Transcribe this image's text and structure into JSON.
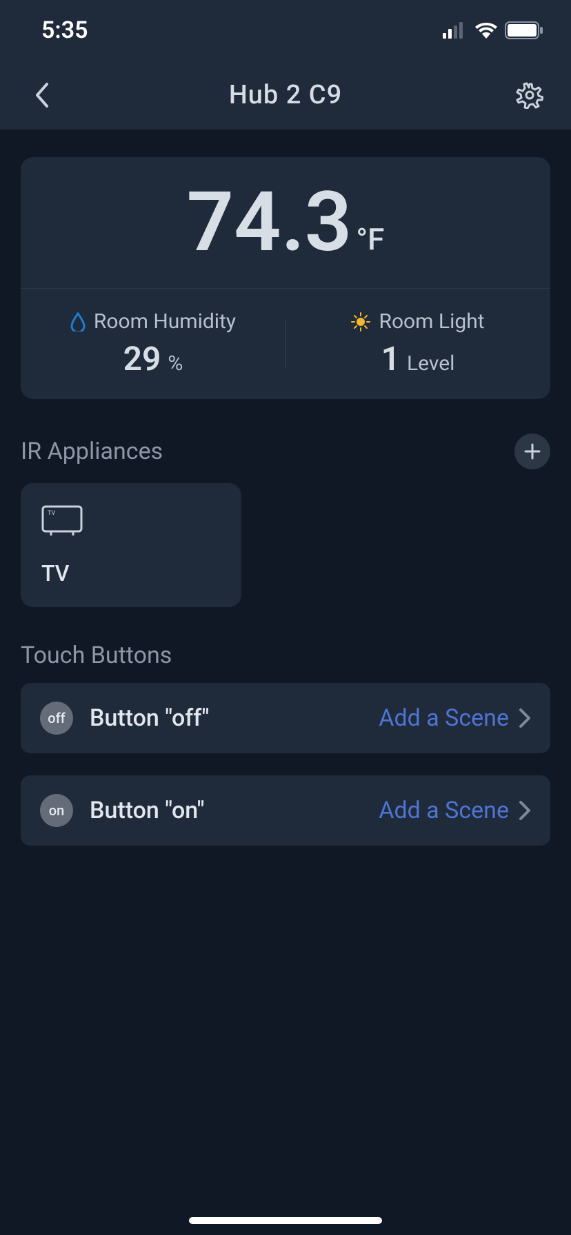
{
  "status": {
    "time": "5:35"
  },
  "header": {
    "title": "Hub 2 C9"
  },
  "temperature": {
    "value": "74.3",
    "unit": "°F",
    "humidity": {
      "label": "Room Humidity",
      "value": "29",
      "suffix": "%"
    },
    "light": {
      "label": "Room Light",
      "value": "1",
      "suffix": "Level"
    }
  },
  "sections": {
    "appliances_title": "IR Appliances",
    "touch_title": "Touch Buttons"
  },
  "appliances": [
    {
      "name": "TV"
    }
  ],
  "touch_buttons": [
    {
      "badge": "off",
      "label": "Button \"off\"",
      "action": "Add a Scene"
    },
    {
      "badge": "on",
      "label": "Button \"on\"",
      "action": "Add a Scene"
    }
  ]
}
